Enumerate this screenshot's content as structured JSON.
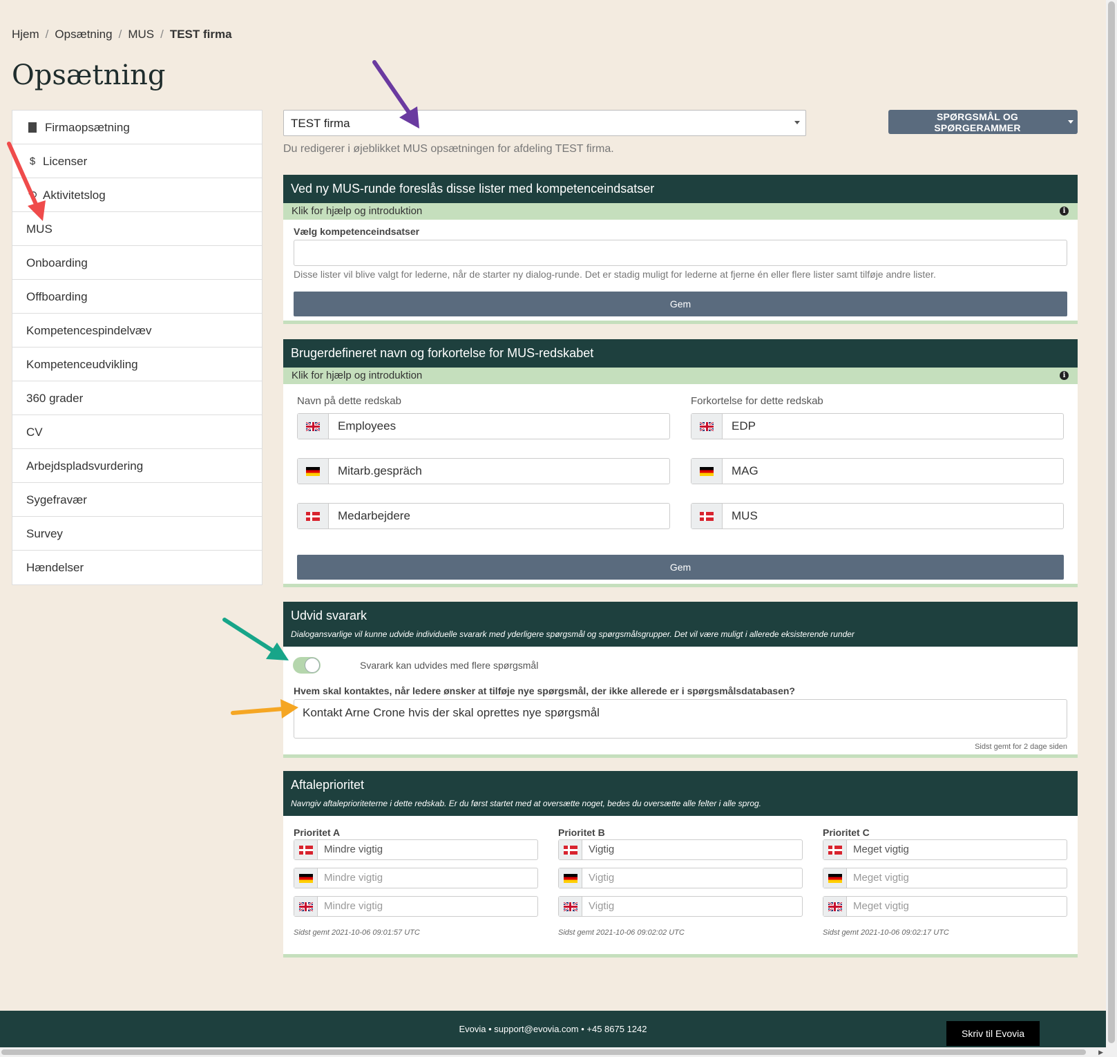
{
  "breadcrumb": {
    "home": "Hjem",
    "setup": "Opsætning",
    "module": "MUS",
    "current": "TEST firma"
  },
  "page_title": "Opsætning",
  "sidebar": {
    "items": [
      {
        "label": "Firmaopsætning",
        "icon": "building-icon"
      },
      {
        "label": "Licenser",
        "icon": "dollar-icon",
        "glyph": "$"
      },
      {
        "label": "Aktivitetslog",
        "icon": "history-icon",
        "glyph": "⟲"
      },
      {
        "label": "MUS"
      },
      {
        "label": "Onboarding"
      },
      {
        "label": "Offboarding"
      },
      {
        "label": "Kompetencespindelvæv"
      },
      {
        "label": "Kompetenceudvikling"
      },
      {
        "label": "360 grader"
      },
      {
        "label": "CV"
      },
      {
        "label": "Arbejdspladsvurdering"
      },
      {
        "label": "Sygefravær"
      },
      {
        "label": "Survey"
      },
      {
        "label": "Hændelser"
      }
    ]
  },
  "company_select": {
    "value": "TEST firma"
  },
  "questions_button": "SPØRGSMÅL OG SPØRGERAMMER",
  "editing_info": "Du redigerer i øjeblikket MUS opsætningen for afdeling TEST firma.",
  "panel1": {
    "title": "Ved ny MUS-runde foreslås disse lister med kompetenceindsatser",
    "help": "Klik for hjælp og introduktion",
    "field_label": "Vælg kompetenceindsatser",
    "field_value": "",
    "hint": "Disse lister vil blive valgt for lederne, når de starter ny dialog-runde. Det er stadig muligt for lederne at fjerne én eller flere lister samt tilføje andre lister.",
    "save": "Gem"
  },
  "panel2": {
    "title": "Brugerdefineret navn og forkortelse for MUS-redskabet",
    "help": "Klik for hjælp og introduktion",
    "name_label": "Navn på dette redskab",
    "abbr_label": "Forkortelse for dette redskab",
    "names": {
      "en": "Employees",
      "de": "Mitarb.gespräch",
      "da": "Medarbejdere"
    },
    "abbrs": {
      "en": "EDP",
      "de": "MAG",
      "da": "MUS"
    },
    "save": "Gem"
  },
  "panel3": {
    "title": "Udvid svarark",
    "subtitle": "Dialogansvarlige vil kunne udvide individuelle svarark med yderligere spørgsmål og spørgsmålsgrupper. Det vil være muligt i allerede eksisterende runder",
    "toggle_on": true,
    "toggle_label": "Svarark kan udvides med flere spørgsmål",
    "contact_label": "Hvem skal kontaktes, når ledere ønsker at tilføje nye spørgsmål, der ikke allerede er i spørgsmålsdatabasen?",
    "contact_value": "Kontakt Arne Crone hvis der skal oprettes nye spørgsmål",
    "saved": "Sidst gemt for 2 dage siden"
  },
  "panel4": {
    "title": "Aftaleprioritet",
    "subtitle": "Navngiv aftaleprioriteterne i dette redskab. Er du først startet med at oversætte noget, bedes du oversætte alle felter i alle sprog.",
    "columns": [
      {
        "label": "Prioritet A",
        "da": "Mindre vigtig",
        "de": "Mindre vigtig",
        "en": "Mindre vigtig",
        "saved": "Sidst gemt 2021-10-06 09:01:57 UTC"
      },
      {
        "label": "Prioritet B",
        "da": "Vigtig",
        "de": "Vigtig",
        "en": "Vigtig",
        "saved": "Sidst gemt 2021-10-06 09:02:02 UTC"
      },
      {
        "label": "Prioritet C",
        "da": "Meget vigtig",
        "de": "Meget vigtig",
        "en": "Meget vigtig",
        "saved": "Sidst gemt 2021-10-06 09:02:17 UTC"
      }
    ]
  },
  "footer": {
    "text": "Evovia • support@evovia.com • +45 8675 1242",
    "contact_button": "Skriv til Evovia"
  },
  "colors": {
    "background": "#f3ebe0",
    "panel_header": "#1e403e",
    "help_bar": "#c5dfbd",
    "button": "#5a6b7e"
  },
  "annotation_arrows": [
    "purple-arrow",
    "red-arrow",
    "green-arrow",
    "orange-arrow"
  ]
}
